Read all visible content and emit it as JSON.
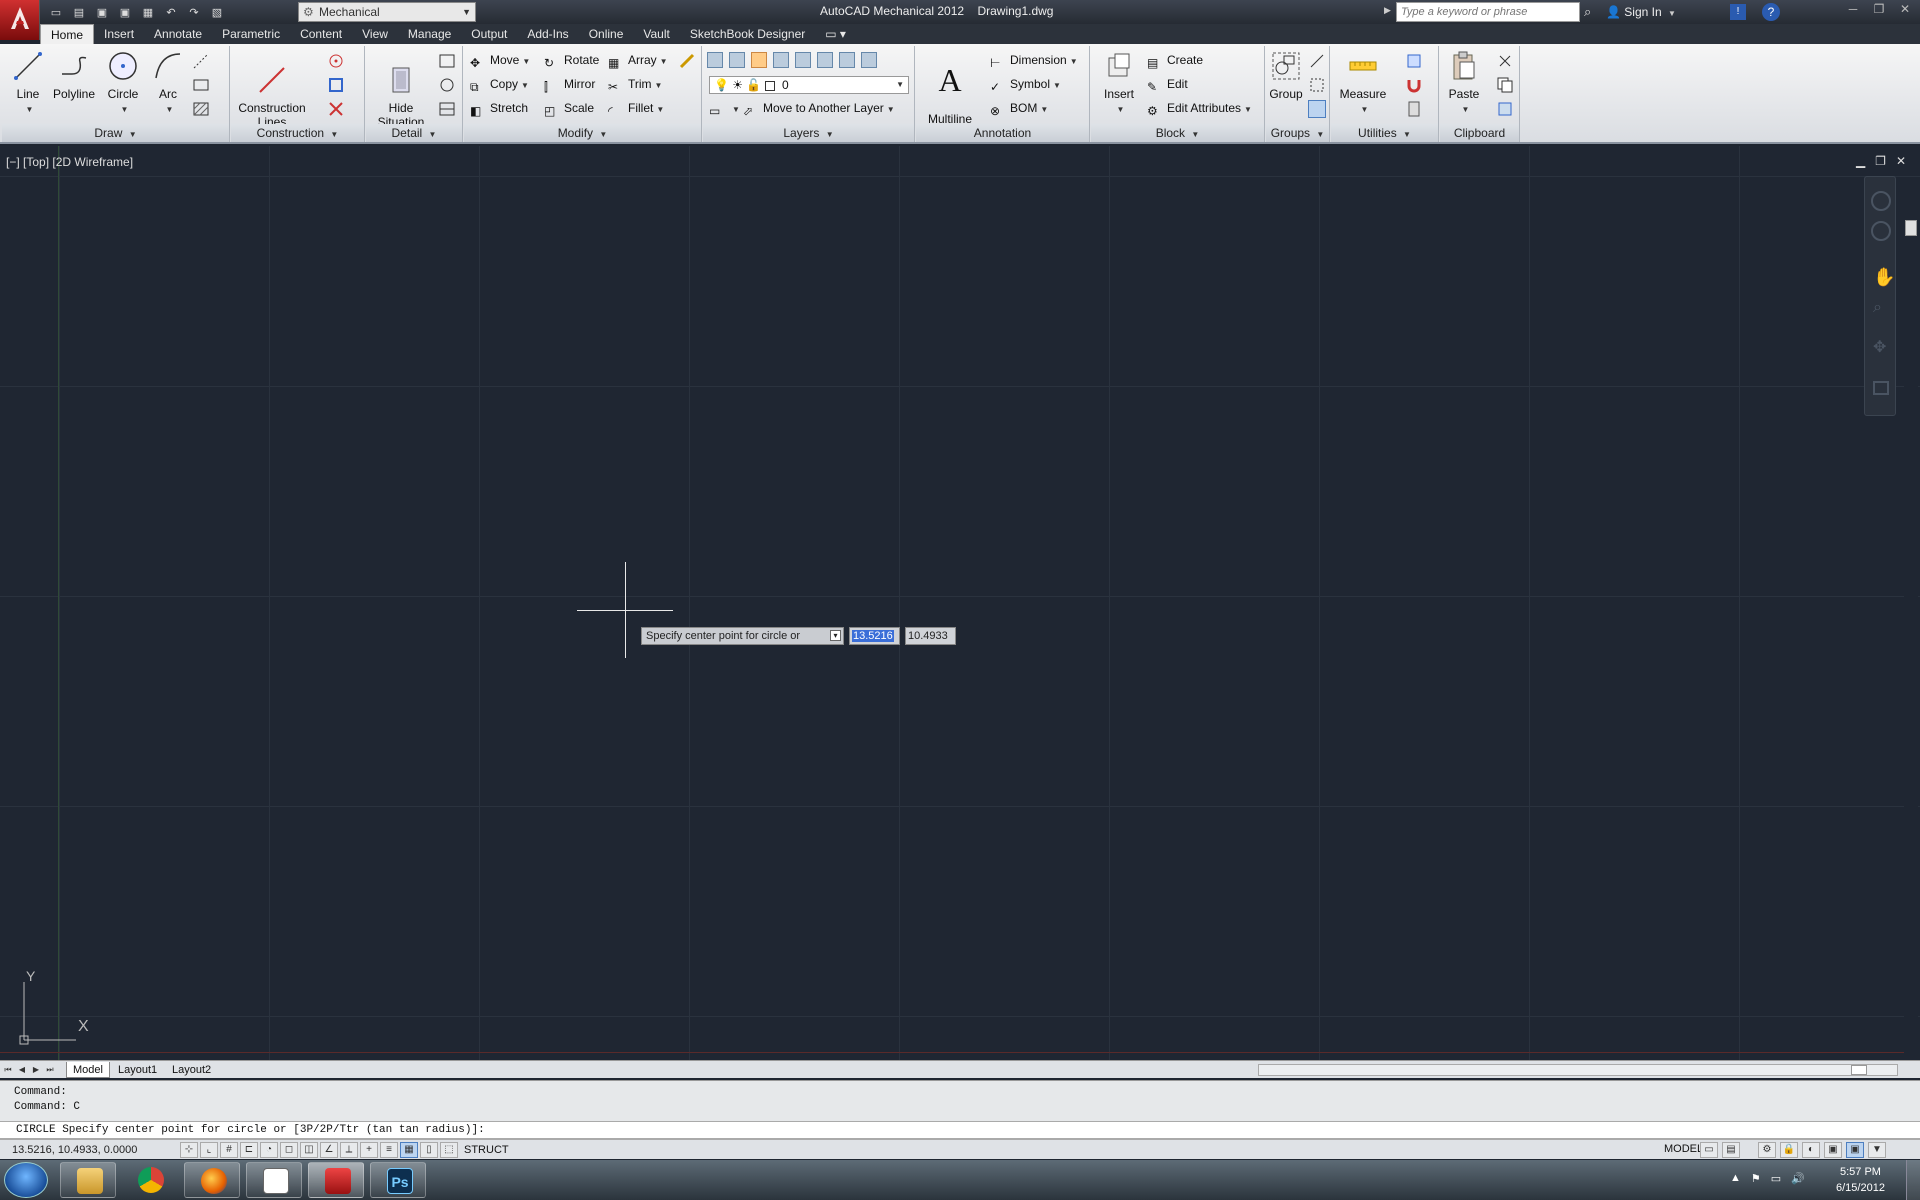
{
  "titlebar": {
    "workspace": "Mechanical",
    "title": "AutoCAD Mechanical 2012",
    "filename": "Drawing1.dwg",
    "search_placeholder": "Type a keyword or phrase",
    "signin": "Sign In"
  },
  "tabs": [
    "Home",
    "Insert",
    "Annotate",
    "Parametric",
    "Content",
    "View",
    "Manage",
    "Output",
    "Add-Ins",
    "Online",
    "Vault",
    "SketchBook Designer"
  ],
  "ribbon": {
    "draw": {
      "title": "Draw",
      "line": "Line",
      "polyline": "Polyline",
      "circle": "Circle",
      "arc": "Arc"
    },
    "construction": {
      "title": "Construction",
      "lines": "Construction\nLines"
    },
    "detail": {
      "title": "Detail",
      "hide": "Hide\nSituation"
    },
    "modify": {
      "title": "Modify",
      "move": "Move",
      "rotate": "Rotate",
      "array": "Array",
      "copy": "Copy",
      "mirror": "Mirror",
      "trim": "Trim",
      "stretch": "Stretch",
      "scale": "Scale",
      "fillet": "Fillet"
    },
    "layers": {
      "title": "Layers",
      "current_layer": "0",
      "move_to_layer": "Move to Another Layer"
    },
    "annotation": {
      "title": "Annotation",
      "mtext": "Multiline\nText",
      "dimension": "Dimension",
      "symbol": "Symbol",
      "bom": "BOM"
    },
    "block": {
      "title": "Block",
      "insert": "Insert",
      "create": "Create",
      "edit": "Edit",
      "edit_attributes": "Edit Attributes"
    },
    "groups": {
      "title": "Groups",
      "group": "Group"
    },
    "utilities": {
      "title": "Utilities",
      "measure": "Measure"
    },
    "clipboard": {
      "title": "Clipboard",
      "paste": "Paste"
    }
  },
  "viewport": {
    "label": "[−] [Top] [2D Wireframe]",
    "prompt": "Specify center point for circle or",
    "x_input": "13.5216",
    "y_input": "10.4933",
    "ucs_x": "X",
    "ucs_y": "Y"
  },
  "layout_tabs": [
    "Model",
    "Layout1",
    "Layout2"
  ],
  "command": {
    "history": [
      "Command:",
      "Command: C"
    ],
    "current": "CIRCLE Specify center point for circle or [3P/2P/Ttr (tan tan radius)]:"
  },
  "status": {
    "coords": "13.5216, 10.4933, 0.0000",
    "struct": "STRUCT",
    "model": "MODEL"
  },
  "taskbar": {
    "time": "5:57 PM",
    "date": "6/15/2012",
    "apps": [
      "windows-explorer",
      "chrome",
      "firefox",
      "document-viewer",
      "autocad",
      "photoshop"
    ],
    "photoshop_label": "Ps"
  },
  "colors": {
    "accent": "#3a6ed8",
    "viewport_bg": "#1f2632",
    "app_red": "#c02020"
  }
}
